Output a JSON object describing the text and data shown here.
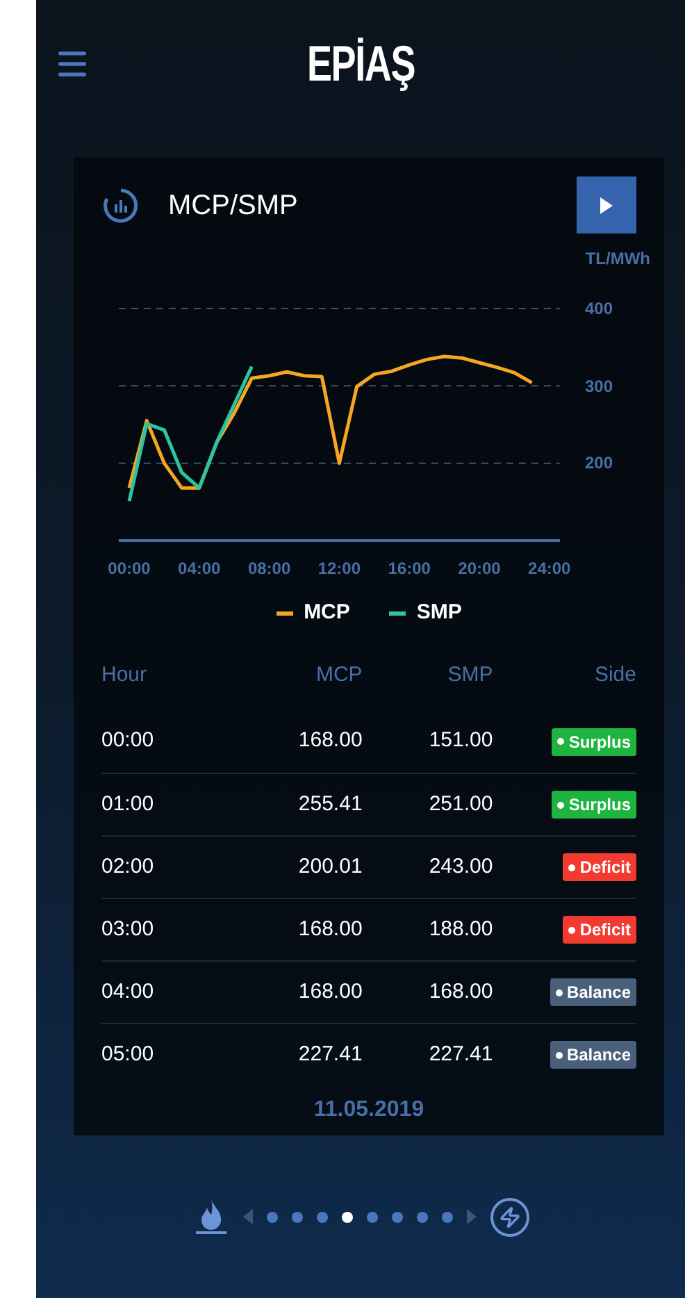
{
  "header": {
    "logo": "EPİAŞ"
  },
  "card": {
    "title": "MCP/SMP",
    "chart_data": {
      "type": "line",
      "ylabel": "TL/MWh",
      "x": [
        0,
        1,
        2,
        3,
        4,
        5,
        6,
        7,
        8,
        9,
        10,
        11,
        12,
        13,
        14,
        15,
        16,
        17,
        18,
        19,
        20,
        21,
        22,
        23
      ],
      "xlim": [
        -0.6,
        24.6
      ],
      "ylim": [
        100,
        400
      ],
      "grid": true,
      "xticks": [
        {
          "value": 0,
          "label": "00:00"
        },
        {
          "value": 4,
          "label": "04:00"
        },
        {
          "value": 8,
          "label": "08:00"
        },
        {
          "value": 12,
          "label": "12:00"
        },
        {
          "value": 16,
          "label": "16:00"
        },
        {
          "value": 20,
          "label": "20:00"
        },
        {
          "value": 24,
          "label": "24:00"
        }
      ],
      "yticks": [
        200,
        300,
        400
      ],
      "series": [
        {
          "name": "MCP",
          "color": "#f5a623",
          "values": [
            168,
            255,
            200,
            168,
            168,
            227,
            265,
            310,
            313,
            318,
            313,
            312,
            200,
            299,
            315,
            319,
            327,
            334,
            338,
            336,
            330,
            324,
            317,
            304
          ]
        },
        {
          "name": "SMP",
          "color": "#2ec4a0",
          "values": [
            151,
            251,
            243,
            188,
            168,
            227,
            276,
            325,
            null,
            null,
            null,
            null,
            null,
            null,
            null,
            null,
            null,
            null,
            null,
            null,
            null,
            null,
            null,
            null
          ]
        }
      ]
    },
    "table": {
      "columns": [
        "Hour",
        "MCP",
        "SMP",
        "Side"
      ],
      "rows": [
        {
          "hour": "00:00",
          "mcp": "168.00",
          "smp": "151.00",
          "side": "Surplus",
          "color": "#1db440"
        },
        {
          "hour": "01:00",
          "mcp": "255.41",
          "smp": "251.00",
          "side": "Surplus",
          "color": "#1db440"
        },
        {
          "hour": "02:00",
          "mcp": "200.01",
          "smp": "243.00",
          "side": "Deficit",
          "color": "#f23b30"
        },
        {
          "hour": "03:00",
          "mcp": "168.00",
          "smp": "188.00",
          "side": "Deficit",
          "color": "#f23b30"
        },
        {
          "hour": "04:00",
          "mcp": "168.00",
          "smp": "168.00",
          "side": "Balance",
          "color": "#4a5f7a"
        },
        {
          "hour": "05:00",
          "mcp": "227.41",
          "smp": "227.41",
          "side": "Balance",
          "color": "#4a5f7a"
        }
      ]
    },
    "date": "11.05.2019"
  },
  "pager": {
    "pages": [
      {
        "selected": false
      },
      {
        "selected": false
      },
      {
        "selected": false
      },
      {
        "selected": true
      },
      {
        "selected": false
      },
      {
        "selected": false
      },
      {
        "selected": false
      },
      {
        "selected": false
      }
    ]
  }
}
